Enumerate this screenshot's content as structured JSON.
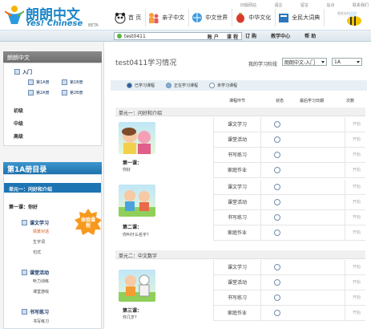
{
  "header": {
    "logo_cn": "朗朗中文",
    "logo_en": "Yes! Chinese",
    "logo_beta": "BETA",
    "top_links": [
      "旧版网站",
      "语言",
      "留言",
      "站点",
      "联系我们"
    ],
    "nav": [
      {
        "label": "首 页",
        "icon": "panda-icon"
      },
      {
        "label": "亲子中文",
        "icon": "family-icon"
      },
      {
        "label": "中文世界",
        "icon": "globe-icon"
      },
      {
        "label": "中华文化",
        "icon": "lantern-icon"
      },
      {
        "label": "全民大词典",
        "icon": "dictionary-icon"
      }
    ],
    "partner": "相关支持单位"
  },
  "userbar": {
    "username": "test0411",
    "account": "账 户",
    "course": "课 程",
    "menu": [
      "订 购",
      "教学中心",
      "帮 助"
    ]
  },
  "sidebar": {
    "panel_title": "朗朗中文",
    "level_title": "入门",
    "books": [
      "第1A册",
      "第1B册",
      "第2A册",
      "第2B册"
    ],
    "levels": [
      "初级",
      "中级",
      "高级"
    ],
    "dir_title": "第1A册目录",
    "unit": "单元一：问好和介绍",
    "lesson": "第一课：你好",
    "badge": "体验课程",
    "sections": [
      {
        "title": "课文学习",
        "items": [
          "情景对话",
          "生字词",
          "句式"
        ]
      },
      {
        "title": "课堂活动",
        "items": [
          "听力训练",
          "课堂游戏"
        ]
      },
      {
        "title": "书写练习",
        "items": [
          "书写练习"
        ]
      }
    ]
  },
  "main": {
    "title": "test0411学习情况",
    "stage_label": "我的学习阶段",
    "stage_value": "朗朗中文-入门",
    "book_value": "1A",
    "legend": [
      "已学习课程",
      "正在学习课程",
      "未学习课程"
    ],
    "columns": [
      "课程环节",
      "状态",
      "最后学习日期",
      "次数"
    ],
    "units": [
      {
        "title": "单元一：问好和介绍",
        "lessons": [
          {
            "title": "第一课：",
            "subtitle": "你好"
          },
          {
            "title": "第二课：",
            "subtitle": "你叫什么名字?"
          }
        ]
      },
      {
        "title": "单元二：中文数字",
        "lessons": [
          {
            "title": "第三课：",
            "subtitle": "你几岁?"
          }
        ]
      }
    ],
    "activities": [
      "课文学习",
      "课堂活动",
      "书写练习",
      "家庭作业"
    ],
    "action": "开始"
  }
}
